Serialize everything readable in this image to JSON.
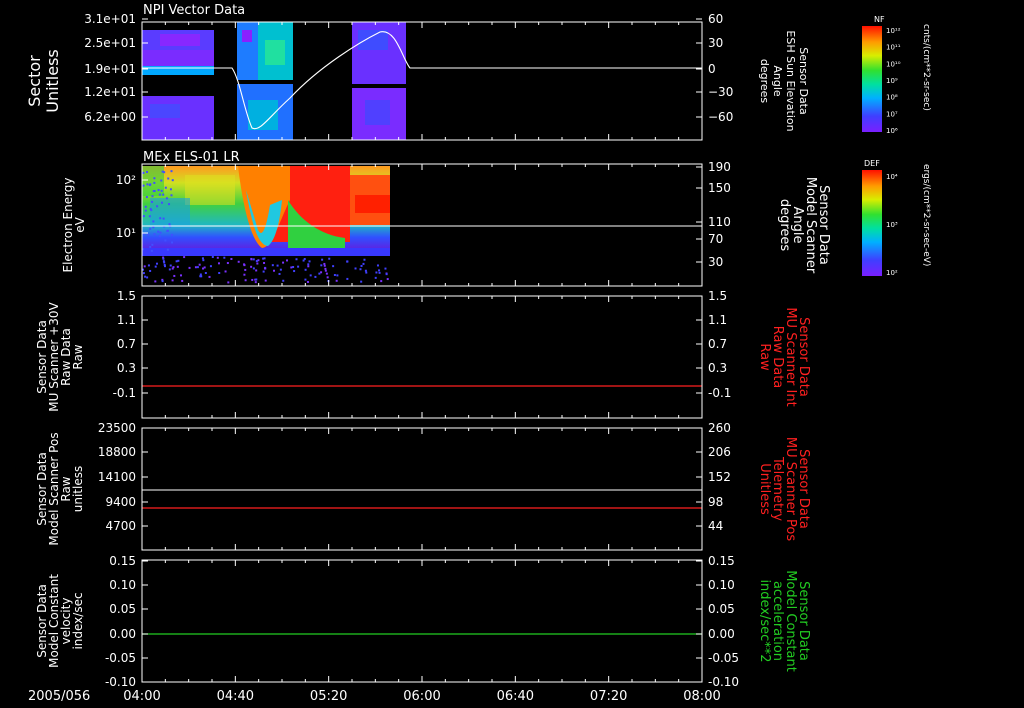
{
  "panels": [
    {
      "key": "npi",
      "title": "NPI Vector Data",
      "left_label": [
        "Sector",
        "Unitless"
      ],
      "left_ticks": [
        "3.1e+01",
        "2.5e+01",
        "1.9e+01",
        "1.2e+01",
        "6.2e+00"
      ],
      "right_label": [
        "Sensor Data",
        "ESH Sun Elevation",
        "Angle",
        "degrees"
      ],
      "right_ticks": [
        "60",
        "30",
        "0",
        "−30",
        "−60"
      ],
      "colorbar": {
        "title": "NF",
        "unit": "cnts/(cm**2-sr-sec)",
        "labels": [
          "10¹²",
          "10¹¹",
          "10¹⁰",
          "10⁹",
          "10⁸",
          "10⁷",
          "10⁶"
        ]
      }
    },
    {
      "key": "els",
      "title": "MEx ELS-01 LR",
      "left_label": [
        "Electron Energy",
        "eV"
      ],
      "left_ticks": [
        "10²",
        "10¹"
      ],
      "right_label": [
        "Sensor Data",
        "Model Scanner",
        "Angle",
        "degrees"
      ],
      "right_ticks": [
        "190",
        "150",
        "110",
        "70",
        "30"
      ],
      "colorbar": {
        "title": "DEF",
        "unit": "ergs/(cm**2-sr-sec-eV)",
        "labels": [
          "10⁴",
          "10³",
          "10²"
        ]
      }
    },
    {
      "key": "raw",
      "title": "",
      "left_label": [
        "Sensor Data",
        "MU Scanner +30V",
        "Raw Data",
        "Raw"
      ],
      "left_ticks": [
        "1.5",
        "1.1",
        "0.7",
        "0.3",
        "-0.1"
      ],
      "right_label": [
        "Sensor Data",
        "MU Scanner Int",
        "Raw Data",
        "Raw"
      ],
      "right_ticks": [
        "1.5",
        "1.1",
        "0.7",
        "0.3",
        "-0.1"
      ]
    },
    {
      "key": "pos",
      "title": "",
      "left_label": [
        "Sensor Data",
        "Model Scanner Pos",
        "Raw",
        "unitless"
      ],
      "left_ticks": [
        "23500",
        "18800",
        "14100",
        "9400",
        "4700"
      ],
      "right_label": [
        "Sensor Data",
        "MU Scanner Pos",
        "Telemetry",
        "Unitless"
      ],
      "right_ticks": [
        "260",
        "206",
        "152",
        "98",
        "44"
      ]
    },
    {
      "key": "vel",
      "title": "",
      "left_label": [
        "Sensor Data",
        "Model Constant",
        "velocity",
        "index/sec"
      ],
      "left_ticks": [
        "0.15",
        "0.10",
        "0.05",
        "0.00",
        "-0.05",
        "-0.10"
      ],
      "right_label": [
        "Sensor Data",
        "Model Constant",
        "acceleration",
        "index/sec**2"
      ],
      "right_ticks": [
        "0.15",
        "0.10",
        "0.05",
        "0.00",
        "-0.05",
        "-0.10"
      ]
    }
  ],
  "time_axis": {
    "date": "2005/056",
    "ticks": [
      "04:00",
      "04:40",
      "05:20",
      "06:00",
      "06:40",
      "07:20",
      "08:00"
    ]
  },
  "colors": {
    "background": "#000000",
    "axis": "#ffffff",
    "red_trace": "#ff2020",
    "green_trace": "#22cc22"
  }
}
